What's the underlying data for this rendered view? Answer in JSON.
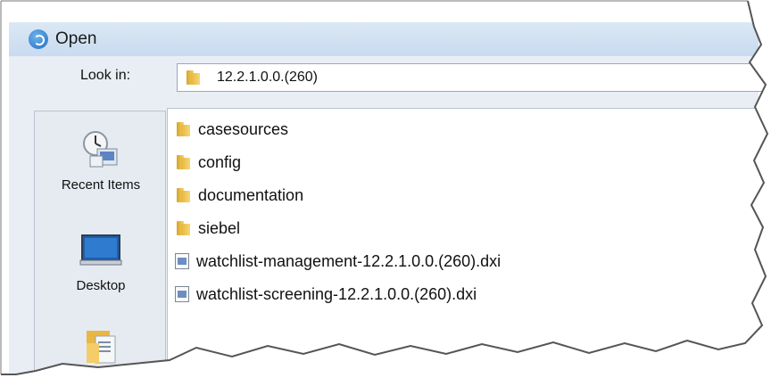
{
  "dialog": {
    "title": "Open",
    "look_in_label": "Look in:",
    "look_in_value": "12.2.1.0.0.(260)"
  },
  "places": [
    {
      "label": "Recent Items",
      "icon": "recent-items-icon"
    },
    {
      "label": "Desktop",
      "icon": "desktop-icon"
    },
    {
      "label": "",
      "icon": "documents-folder-icon"
    }
  ],
  "files": [
    {
      "name": "casesources",
      "type": "folder"
    },
    {
      "name": "config",
      "type": "folder"
    },
    {
      "name": "documentation",
      "type": "folder"
    },
    {
      "name": "siebel",
      "type": "folder"
    },
    {
      "name": "watchlist-management-12.2.1.0.0.(260).dxi",
      "type": "file"
    },
    {
      "name": "watchlist-screening-12.2.1.0.0.(260).dxi",
      "type": "file"
    }
  ],
  "colors": {
    "titlebar": "#c9dbef",
    "panel": "#e9eef5",
    "folder": "#e8b73a"
  }
}
